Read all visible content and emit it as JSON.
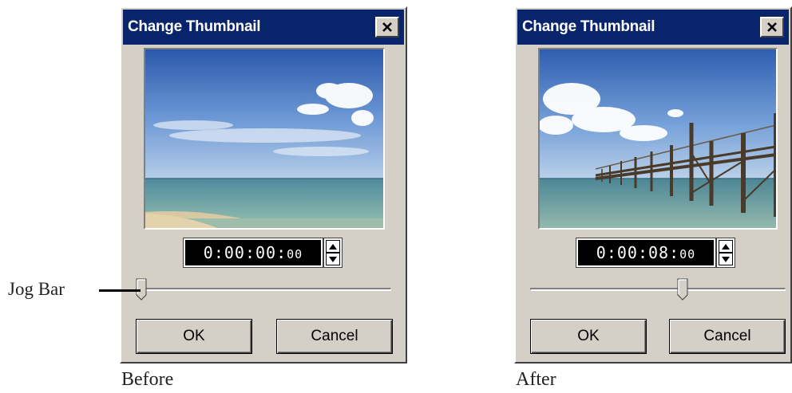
{
  "before": {
    "title": "Change Thumbnail",
    "timecode": "0:00:00:",
    "timecode_frames": "00",
    "jog_position": 0.0,
    "ok_label": "OK",
    "cancel_label": "Cancel",
    "caption": "Before"
  },
  "after": {
    "title": "Change Thumbnail",
    "timecode": "0:00:08:",
    "timecode_frames": "00",
    "jog_position": 0.6,
    "ok_label": "OK",
    "cancel_label": "Cancel",
    "caption": "After"
  },
  "annotation": {
    "label": "Jog Bar"
  },
  "colors": {
    "titlebar": "#08246b",
    "dialog_face": "#d4d0c8"
  },
  "icons": {
    "close": "close-icon",
    "spin_up": "triangle-up-icon",
    "spin_down": "triangle-down-icon"
  }
}
